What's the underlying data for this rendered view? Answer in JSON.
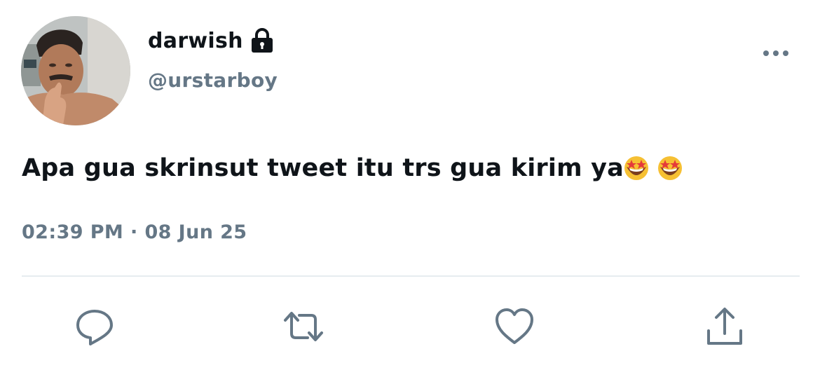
{
  "tweet": {
    "author": {
      "display_name": "darwish",
      "handle": "@urstarboy",
      "protected_icon": "lock-icon",
      "avatar": "profile-photo"
    },
    "text": "Apa gua skrinsut tweet itu trs gua kirim ya",
    "emojis": [
      "star-struck-emoji",
      "star-struck-emoji"
    ],
    "timestamp": "02:39 PM · 08 Jun 25"
  },
  "menu_icon": "more-icon",
  "actions": [
    {
      "icon": "reply-icon"
    },
    {
      "icon": "retweet-icon"
    },
    {
      "icon": "like-icon"
    },
    {
      "icon": "share-icon"
    }
  ],
  "colors": {
    "text_primary": "#0f1419",
    "text_secondary": "#657786",
    "divider": "#e6ecf0",
    "icon": "#657786"
  }
}
